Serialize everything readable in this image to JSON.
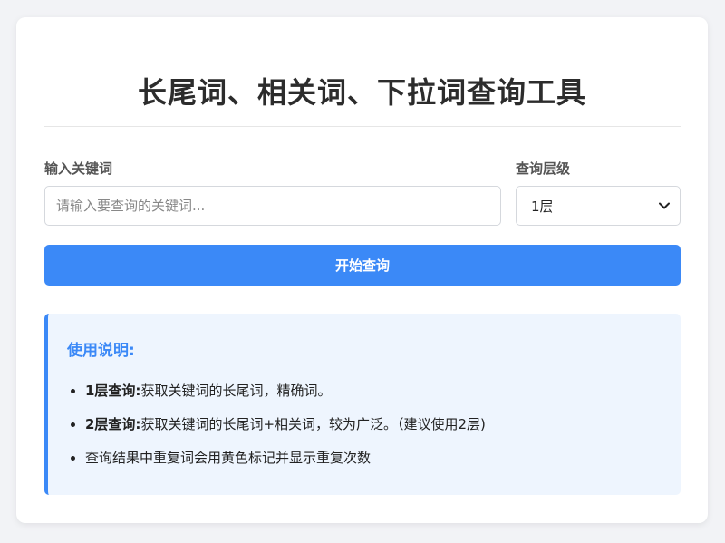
{
  "title": "长尾词、相关词、下拉词查询工具",
  "form": {
    "keyword_label": "输入关键词",
    "keyword_placeholder": "请输入要查询的关键词...",
    "keyword_value": "",
    "level_label": "查询层级",
    "level_selected": "1层",
    "submit_label": "开始查询"
  },
  "instructions": {
    "title": "使用说明:",
    "items": [
      {
        "strong": "1层查询:",
        "text": "获取关键词的长尾词，精确词。"
      },
      {
        "strong": "2层查询:",
        "text": "获取关键词的长尾词+相关词，较为广泛。（建议使用2层)"
      },
      {
        "strong": "",
        "text": "查询结果中重复词会用黄色标记并显示重复次数"
      }
    ]
  },
  "colors": {
    "accent": "#3b89f7",
    "info_bg": "#eef5fe",
    "page_bg": "#f2f3f6"
  },
  "icons": {
    "select_arrow": "chevron-down-icon"
  }
}
